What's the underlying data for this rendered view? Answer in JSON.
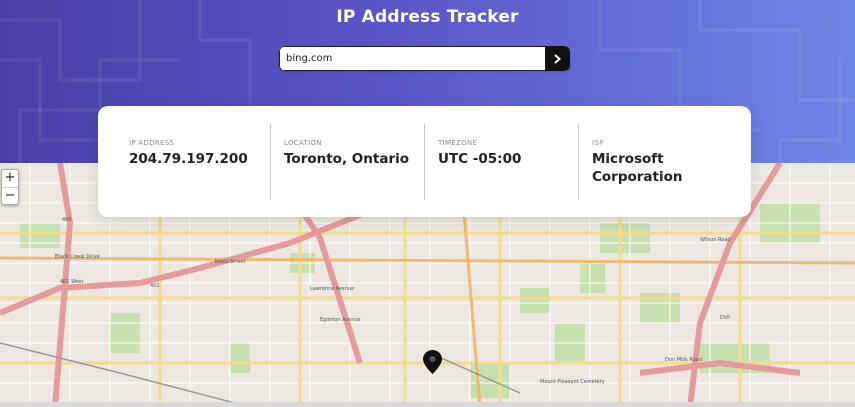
{
  "header": {
    "title": "IP Address Tracker"
  },
  "search": {
    "value": "bing.com",
    "button_icon": "chevron-right-icon"
  },
  "info": {
    "ip": {
      "label": "IP ADDRESS",
      "value": "204.79.197.200"
    },
    "location": {
      "label": "LOCATION",
      "value": "Toronto, Ontario"
    },
    "timezone": {
      "label": "TIMEZONE",
      "value": "UTC -05:00"
    },
    "isp": {
      "label": "ISP",
      "value": "Microsoft Corporation"
    }
  },
  "map": {
    "zoom_in": "+",
    "zoom_out": "−",
    "labels": {
      "highway_400": "400",
      "highway_401": "401",
      "dvp": "DVP",
      "lawrence": "Lawrence Avenue",
      "eglinton": "Eglinton Avenue",
      "mount_pleasant": "Mount Pleasant Cemetery",
      "don_mills": "Don Mills Road",
      "black_creek": "Black Creek Drive",
      "wilson": "Wilson Road",
      "yorkdale": "401 West",
      "keele": "Keele Street"
    },
    "colors": {
      "major_road": "#e8a0a0",
      "minor_road": "#f4e8a6",
      "park": "#c8dfb0",
      "water": "#aad3df"
    }
  },
  "colors": {
    "header_start": "#4b3fa8",
    "header_end": "#6e86e6",
    "button": "#111111"
  }
}
